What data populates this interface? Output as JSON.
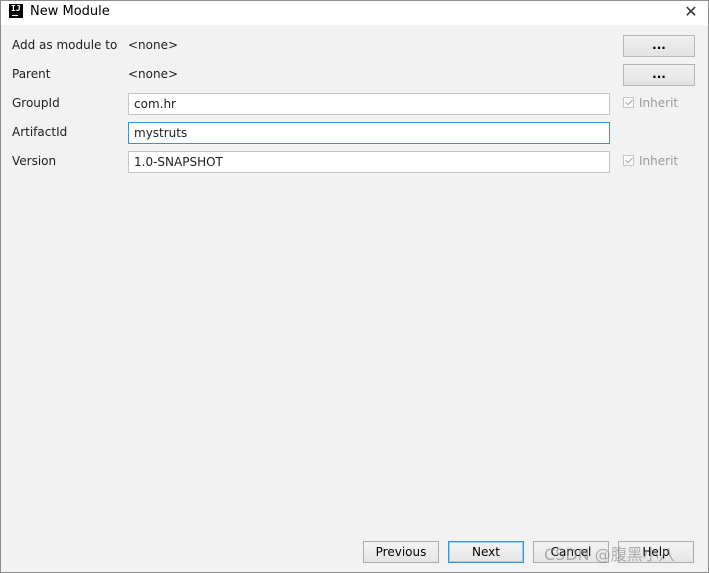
{
  "window": {
    "title": "New Module",
    "close_glyph": "✕"
  },
  "form": {
    "add_as_module_to": {
      "label": "Add as module to",
      "value": "<none>",
      "button_label": "..."
    },
    "parent": {
      "label": "Parent",
      "value": "<none>",
      "button_label": "..."
    },
    "group_id": {
      "label": "GroupId",
      "value": "com.hr",
      "inherit_label": "Inherit",
      "inherit_checked": true
    },
    "artifact_id": {
      "label": "ArtifactId",
      "value": "mystruts"
    },
    "version": {
      "label": "Version",
      "value": "1.0-SNAPSHOT",
      "inherit_label": "Inherit",
      "inherit_checked": true
    }
  },
  "footer": {
    "previous_label": "Previous",
    "next_label": "Next",
    "cancel_label": "Cancel",
    "help_label": "Help"
  },
  "watermark": "CSDN @腹黑小八",
  "icons": {
    "app": "intellij-idea-icon",
    "close": "close-icon"
  }
}
